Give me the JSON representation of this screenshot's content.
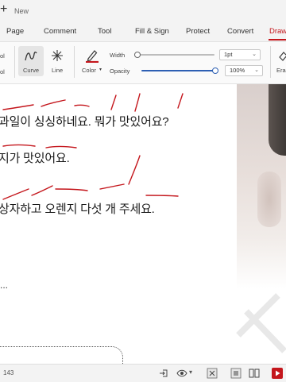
{
  "titlebar": {
    "new_label": "New"
  },
  "menu": {
    "tabs": [
      "Page",
      "Comment",
      "Tool",
      "Fill & Sign",
      "Protect",
      "Convert",
      "Draw"
    ],
    "active": "Draw"
  },
  "ribbon": {
    "left_small_1": "ol",
    "left_small_2": "ol",
    "curve_label": "Curve",
    "line_label": "Line",
    "color_label": "Color",
    "width_label": "Width",
    "opacity_label": "Opacity",
    "width_value": "1pt",
    "opacity_value": "100%",
    "width_slider_level": 0.0,
    "opacity_slider_level": 1.0,
    "eraser_label": "Era",
    "pen_color": "#c4161c",
    "accent_color": "#2d5fb3"
  },
  "document": {
    "lines": [
      "과일이 싱싱하네요. 뭐가 맛있어요?",
      "지가 맛있어요.",
      "상자하고 오렌지 다섯 개 주세요."
    ],
    "ellipsis": "..."
  },
  "statusbar": {
    "page_indicator": "143"
  }
}
